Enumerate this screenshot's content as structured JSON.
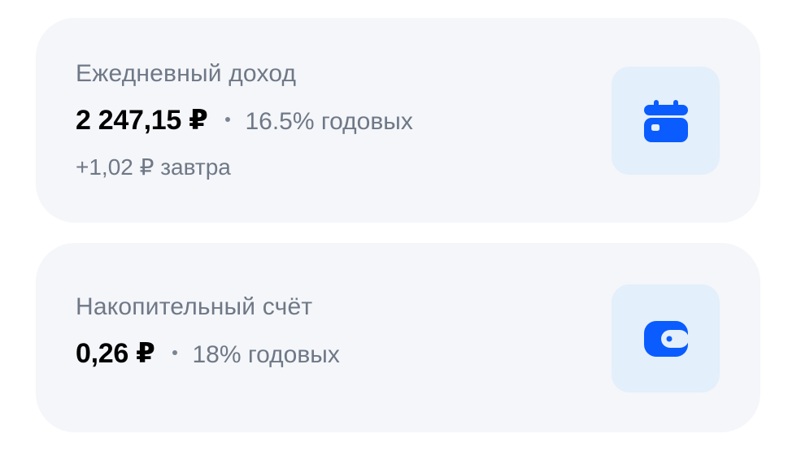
{
  "theme": {
    "card_background": "#f4f6fa",
    "icon_tile_background": "#e3effa",
    "accent": "#0a5cff",
    "muted_text": "#6f7886"
  },
  "cards": [
    {
      "title": "Ежедневный доход",
      "amount": "2 247,15 ₽",
      "rate": "16.5% годовых",
      "subline": "+1,02 ₽ завтра",
      "icon": "calendar-icon"
    },
    {
      "title": "Накопительный счёт",
      "amount": "0,26 ₽",
      "rate": "18% годовых",
      "icon": "wallet-icon"
    }
  ]
}
